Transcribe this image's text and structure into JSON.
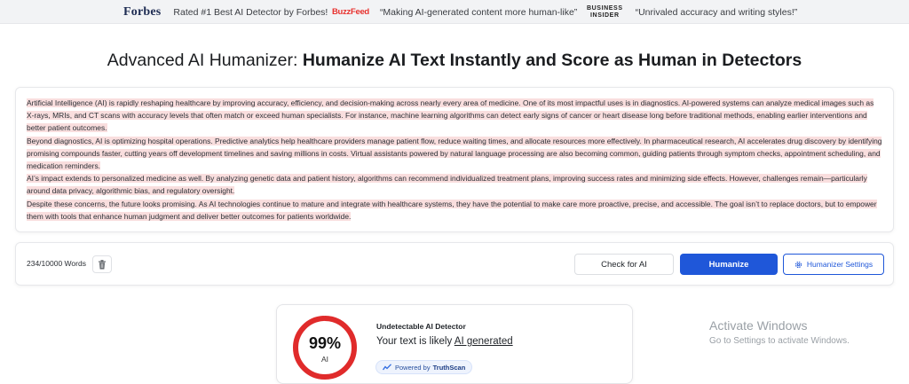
{
  "press_bar": [
    {
      "source": "Forbes",
      "quote": "Rated #1 Best AI Detector by Forbes!"
    },
    {
      "source": "BuzzFeed",
      "quote": "“Making AI-generated content more human-like”"
    },
    {
      "source_line1": "BUSINESS",
      "source_line2": "INSIDER",
      "quote": "“Unrivaled accuracy and writing styles!”"
    }
  ],
  "headline": {
    "lead": "Advanced AI Humanizer:",
    "main": "Humanize AI Text Instantly and Score as Human in Detectors"
  },
  "editor": {
    "paragraphs": [
      "Artificial Intelligence (AI) is rapidly reshaping healthcare by improving accuracy, efficiency, and decision-making across nearly every area of medicine. One of its most impactful uses is in diagnostics. AI-powered systems can analyze medical images such as X-rays, MRIs, and CT scans with accuracy levels that often match or exceed human specialists. For instance, machine learning algorithms can detect early signs of cancer or heart disease long before traditional methods, enabling earlier interventions and better patient outcomes.",
      " Beyond diagnostics, AI is optimizing hospital operations. Predictive analytics help healthcare providers manage patient flow, reduce waiting times, and allocate resources more effectively. In pharmaceutical research, AI accelerates drug discovery by identifying promising compounds faster, cutting years off development timelines and saving millions in costs. Virtual assistants powered by natural language processing are also becoming common, guiding patients through symptom checks, appointment scheduling, and medication reminders.",
      " AI’s impact extends to personalized medicine as well. By analyzing genetic data and patient history, algorithms can recommend individualized treatment plans, improving success rates and minimizing side effects. However, challenges remain—particularly around data privacy, algorithmic bias, and regulatory oversight.",
      " Despite these concerns, the future looks promising. As AI technologies continue to mature and integrate with healthcare systems, they have the potential to make care more proactive, precise, and accessible. The goal isn’t to replace doctors, but to empower them with tools that enhance human judgment and deliver better outcomes for patients worldwide."
    ],
    "highlight_color": "#f9dede"
  },
  "toolbar": {
    "word_count": "234/10000 Words",
    "check_label": "Check for AI",
    "humanize_label": "Humanize",
    "settings_label": "Humanizer Settings",
    "primary_color": "#1f57d9"
  },
  "result": {
    "title": "Undetectable AI Detector",
    "percent": "99%",
    "percent_value": 0.99,
    "sub": "AI",
    "line_prefix": "Your text is likely ",
    "verdict": "AI generated",
    "powered_prefix": "Powered by",
    "powered_brand": "TruthScan",
    "gauge_color": "#e02b2b"
  },
  "watermark": {
    "title": "Activate Windows",
    "subtitle": "Go to Settings to activate Windows."
  }
}
